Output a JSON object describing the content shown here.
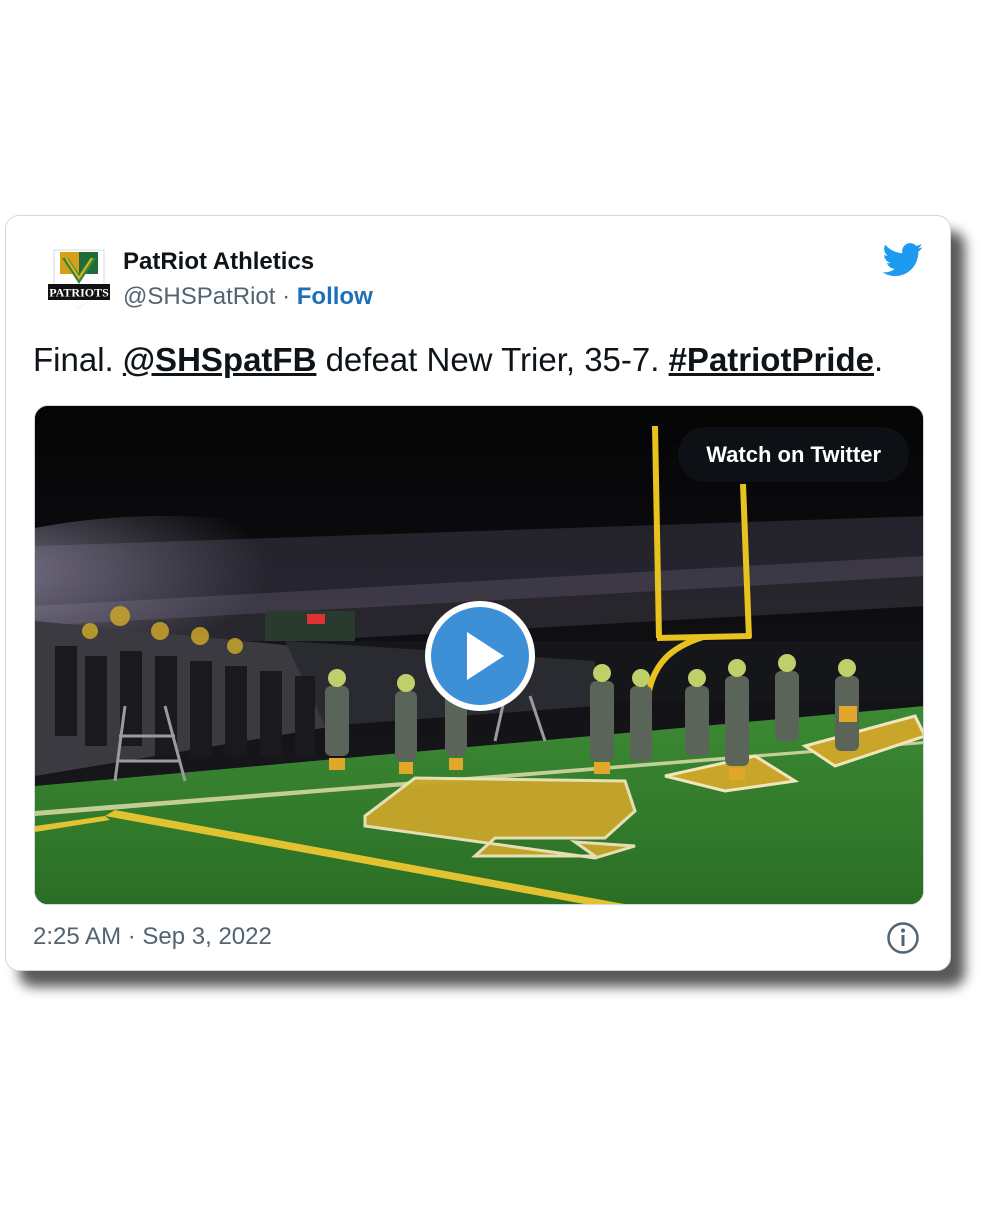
{
  "author": {
    "name": "PatRiot Athletics",
    "handle": "@SHSPatRiot",
    "separator": "·",
    "follow_label": "Follow",
    "avatar_text": "PATRIOTS"
  },
  "tweet": {
    "prefix": "Final. ",
    "mention": "@SHSpatFB",
    "middle": " defeat New Trier, 35-7. ",
    "hashtag": "#PatriotPride",
    "suffix": "."
  },
  "media": {
    "watch_label": "Watch on Twitter",
    "play_icon": "play-icon"
  },
  "footer": {
    "time": "2:25 AM",
    "separator": "·",
    "date": "Sep 3, 2022",
    "info_icon": "info-icon"
  },
  "colors": {
    "twitter_blue": "#1d9bf0",
    "follow_blue": "#1d6fb8",
    "play_blue": "#3d8fd6",
    "text": "#0f1419",
    "muted": "#536471",
    "turf": "#2f7d2a",
    "goalpost_yellow": "#e8c21f"
  }
}
